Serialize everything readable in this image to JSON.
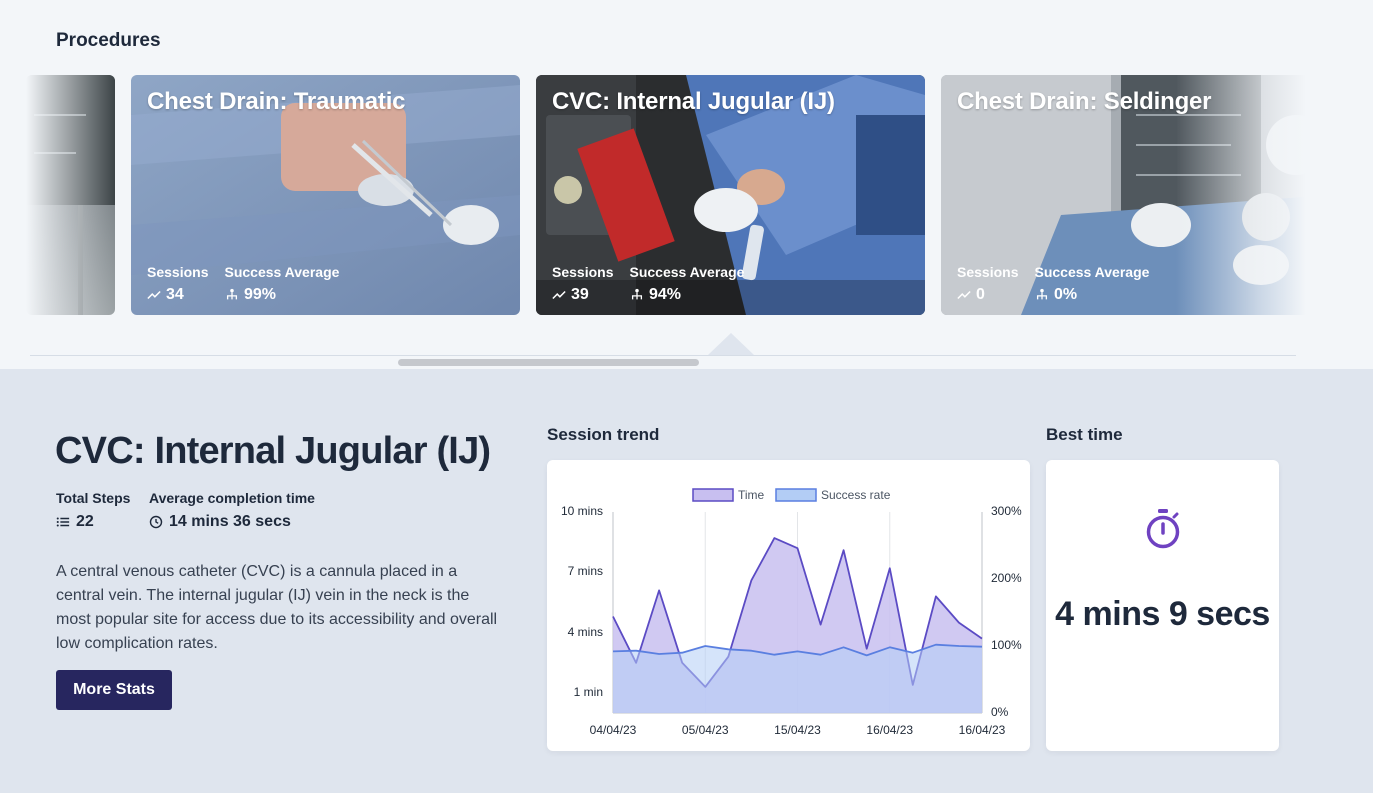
{
  "section_title": "Procedures",
  "cards": [
    {
      "title": "Chest Drain: Traumatic",
      "sessions_label": "Sessions",
      "success_label": "Success Average",
      "sessions": "34",
      "success": "99%"
    },
    {
      "title": "CVC: Internal Jugular (IJ)",
      "sessions_label": "Sessions",
      "success_label": "Success Average",
      "sessions": "39",
      "success": "94%"
    },
    {
      "title": "Chest Drain: Seldinger",
      "sessions_label": "Sessions",
      "success_label": "Success Average",
      "sessions": "0",
      "success": "0%"
    }
  ],
  "detail": {
    "title": "CVC: Internal Jugular (IJ)",
    "total_steps_label": "Total Steps",
    "total_steps": "22",
    "avg_time_label": "Average completion time",
    "avg_time": "14 mins 36 secs",
    "description": "A central venous catheter (CVC) is a cannula placed in a central vein. The internal jugular (IJ) vein in the neck is the most popular site for access due to its accessibility and overall low complication rates.",
    "more_stats_label": "More Stats"
  },
  "trend_label": "Session trend",
  "best_label": "Best time",
  "best_time": "4 mins 9 secs",
  "colors": {
    "accent": "#27265f",
    "time_line": "#5b4bc4",
    "time_fill": "#c8bff0",
    "rate_line": "#5a7fe0",
    "rate_fill": "#b3cdf5",
    "icon": "#6f42c1"
  },
  "chart_data": {
    "type": "area",
    "legend": [
      "Time",
      "Success rate"
    ],
    "legend_position": "top",
    "x_ticks": [
      "04/04/23",
      "05/04/23",
      "15/04/23",
      "16/04/23",
      "16/04/23"
    ],
    "y_left_ticks": [
      "10 mins",
      "7 mins",
      "4 mins",
      "1 min"
    ],
    "y_right_ticks": [
      "300%",
      "200%",
      "100%",
      "0%"
    ],
    "y_left_range_mins": [
      0,
      10
    ],
    "y_right_range_pct": [
      0,
      300
    ],
    "series": [
      {
        "name": "Time",
        "axis": "left",
        "unit": "mins",
        "values": [
          4.8,
          2.5,
          6.1,
          2.5,
          1.3,
          2.8,
          6.6,
          8.7,
          8.2,
          4.4,
          8.1,
          3.2,
          7.2,
          1.4,
          5.8,
          4.5,
          3.7
        ]
      },
      {
        "name": "Success rate",
        "axis": "right",
        "unit": "%",
        "values": [
          92,
          93,
          88,
          90,
          100,
          95,
          93,
          87,
          92,
          87,
          98,
          86,
          98,
          90,
          102,
          100,
          99
        ]
      }
    ]
  }
}
